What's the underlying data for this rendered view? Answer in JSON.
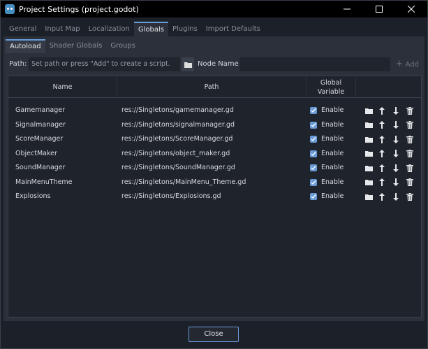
{
  "window": {
    "title": "Project Settings (project.godot)"
  },
  "tabs": [
    "General",
    "Input Map",
    "Localization",
    "Globals",
    "Plugins",
    "Import Defaults"
  ],
  "active_tab": "Globals",
  "subtabs": [
    "Autoload",
    "Shader Globals",
    "Groups"
  ],
  "active_subtab": "Autoload",
  "pathbar": {
    "path_label": "Path:",
    "path_placeholder": "Set path or press \"Add\" to create a script.",
    "node_name_label": "Node Name:",
    "add_label": "Add"
  },
  "table": {
    "headers": {
      "name": "Name",
      "path": "Path",
      "global_line1": "Global",
      "global_line2": "Variable"
    },
    "rows": [
      {
        "name": "Gamemanager",
        "path": "res://Singletons/gamemanager.gd",
        "enabled": true,
        "enable_label": "Enable"
      },
      {
        "name": "Signalmanager",
        "path": "res://Singletons/signalmanager.gd",
        "enabled": true,
        "enable_label": "Enable"
      },
      {
        "name": "ScoreManager",
        "path": "res://Singletons/ScoreManager.gd",
        "enabled": true,
        "enable_label": "Enable"
      },
      {
        "name": "ObjectMaker",
        "path": "res://Singletons/object_maker.gd",
        "enabled": true,
        "enable_label": "Enable"
      },
      {
        "name": "SoundManager",
        "path": "res://Singletons/SoundManager.gd",
        "enabled": true,
        "enable_label": "Enable"
      },
      {
        "name": "MainMenuTheme",
        "path": "res://Singletons/MainMenu_Theme.gd",
        "enabled": true,
        "enable_label": "Enable"
      },
      {
        "name": "Explosions",
        "path": "res://Singletons/Explosions.gd",
        "enabled": true,
        "enable_label": "Enable"
      }
    ]
  },
  "footer": {
    "close_label": "Close"
  },
  "colors": {
    "accent": "#6a9bd8",
    "panel": "#2b303a",
    "background": "#1c2028"
  }
}
